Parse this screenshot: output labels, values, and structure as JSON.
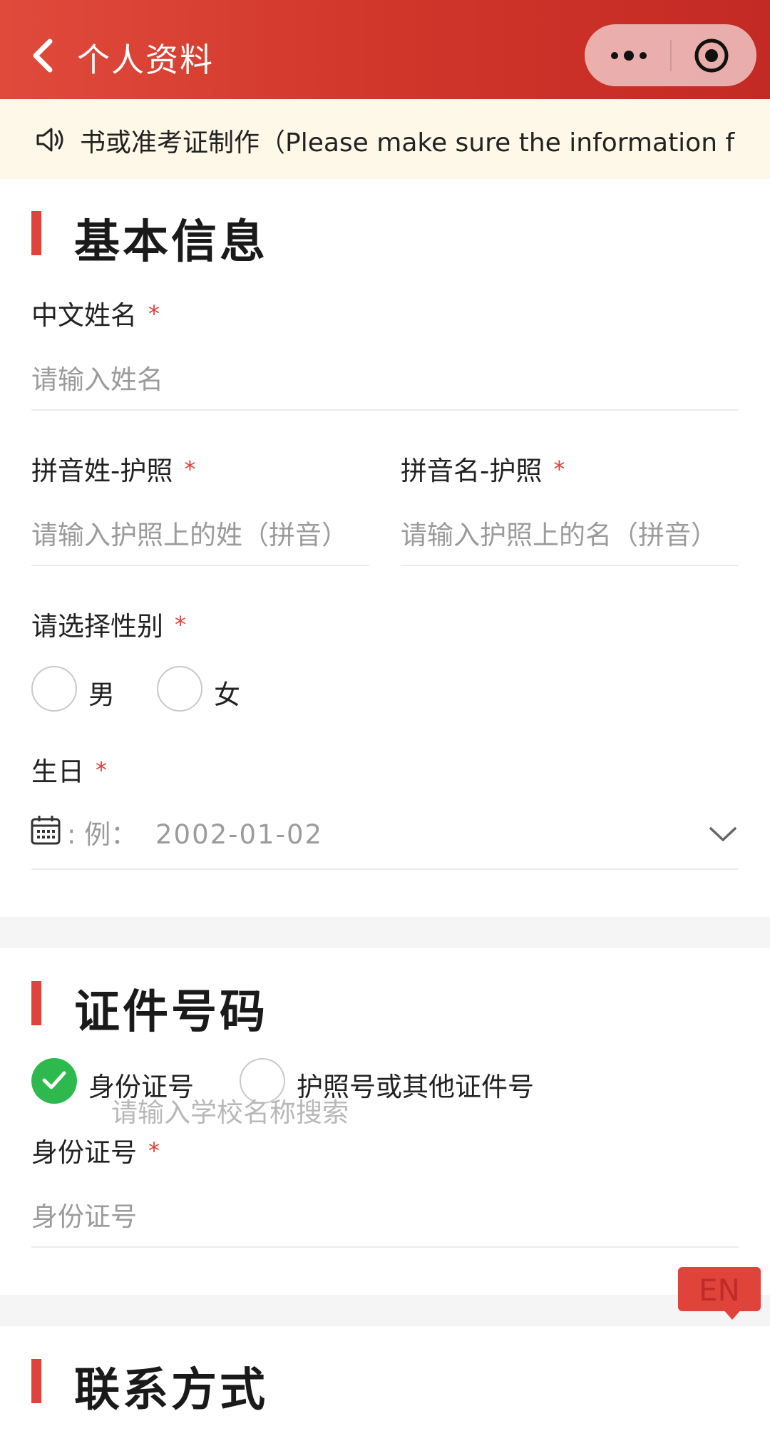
{
  "header": {
    "title": "个人资料"
  },
  "notice": {
    "text": "书或准考证制作（Please make sure the information f"
  },
  "basic_info": {
    "section_title": "基本信息",
    "chinese_name": {
      "label": "中文姓名",
      "required_mark": "*",
      "placeholder": "请输入姓名"
    },
    "pinyin_surname": {
      "label": "拼音姓-护照",
      "required_mark": "*",
      "placeholder": "请输入护照上的姓（拼音）"
    },
    "pinyin_given": {
      "label": "拼音名-护照",
      "required_mark": "*",
      "placeholder": "请输入护照上的名（拼音）"
    },
    "gender": {
      "label": "请选择性别",
      "required_mark": "*",
      "options": [
        "男",
        "女"
      ]
    },
    "birthday": {
      "label": "生日",
      "required_mark": "*",
      "prefix": ": 例：",
      "placeholder": "2002-01-02"
    }
  },
  "id_info": {
    "section_title": "证件号码",
    "options": [
      "身份证号",
      "护照号或其他证件号"
    ],
    "selected": "身份证号",
    "overlay_placeholder": "请输入学校名称搜索",
    "id_number": {
      "label": "身份证号",
      "required_mark": "*",
      "placeholder": "身份证号"
    }
  },
  "contact": {
    "section_title": "联系方式"
  },
  "lang_button": {
    "label": "EN"
  },
  "colors": {
    "accent": "#e0433a",
    "check": "#2db94d",
    "notice_bg": "#fdf8e8"
  },
  "icons": [
    "back-icon",
    "more-icon",
    "target-icon",
    "speaker-icon",
    "calendar-icon",
    "chevron-down-icon",
    "check-icon"
  ]
}
